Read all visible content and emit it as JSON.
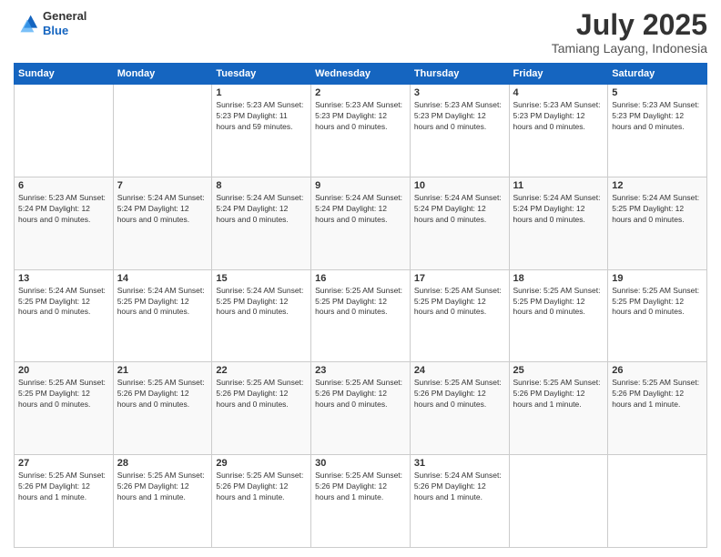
{
  "logo": {
    "line1": "General",
    "line2": "Blue"
  },
  "header": {
    "month": "July 2025",
    "location": "Tamiang Layang, Indonesia"
  },
  "weekdays": [
    "Sunday",
    "Monday",
    "Tuesday",
    "Wednesday",
    "Thursday",
    "Friday",
    "Saturday"
  ],
  "weeks": [
    [
      {
        "day": "",
        "info": ""
      },
      {
        "day": "",
        "info": ""
      },
      {
        "day": "1",
        "info": "Sunrise: 5:23 AM\nSunset: 5:23 PM\nDaylight: 11 hours\nand 59 minutes."
      },
      {
        "day": "2",
        "info": "Sunrise: 5:23 AM\nSunset: 5:23 PM\nDaylight: 12 hours\nand 0 minutes."
      },
      {
        "day": "3",
        "info": "Sunrise: 5:23 AM\nSunset: 5:23 PM\nDaylight: 12 hours\nand 0 minutes."
      },
      {
        "day": "4",
        "info": "Sunrise: 5:23 AM\nSunset: 5:23 PM\nDaylight: 12 hours\nand 0 minutes."
      },
      {
        "day": "5",
        "info": "Sunrise: 5:23 AM\nSunset: 5:23 PM\nDaylight: 12 hours\nand 0 minutes."
      }
    ],
    [
      {
        "day": "6",
        "info": "Sunrise: 5:23 AM\nSunset: 5:24 PM\nDaylight: 12 hours\nand 0 minutes."
      },
      {
        "day": "7",
        "info": "Sunrise: 5:24 AM\nSunset: 5:24 PM\nDaylight: 12 hours\nand 0 minutes."
      },
      {
        "day": "8",
        "info": "Sunrise: 5:24 AM\nSunset: 5:24 PM\nDaylight: 12 hours\nand 0 minutes."
      },
      {
        "day": "9",
        "info": "Sunrise: 5:24 AM\nSunset: 5:24 PM\nDaylight: 12 hours\nand 0 minutes."
      },
      {
        "day": "10",
        "info": "Sunrise: 5:24 AM\nSunset: 5:24 PM\nDaylight: 12 hours\nand 0 minutes."
      },
      {
        "day": "11",
        "info": "Sunrise: 5:24 AM\nSunset: 5:24 PM\nDaylight: 12 hours\nand 0 minutes."
      },
      {
        "day": "12",
        "info": "Sunrise: 5:24 AM\nSunset: 5:25 PM\nDaylight: 12 hours\nand 0 minutes."
      }
    ],
    [
      {
        "day": "13",
        "info": "Sunrise: 5:24 AM\nSunset: 5:25 PM\nDaylight: 12 hours\nand 0 minutes."
      },
      {
        "day": "14",
        "info": "Sunrise: 5:24 AM\nSunset: 5:25 PM\nDaylight: 12 hours\nand 0 minutes."
      },
      {
        "day": "15",
        "info": "Sunrise: 5:24 AM\nSunset: 5:25 PM\nDaylight: 12 hours\nand 0 minutes."
      },
      {
        "day": "16",
        "info": "Sunrise: 5:25 AM\nSunset: 5:25 PM\nDaylight: 12 hours\nand 0 minutes."
      },
      {
        "day": "17",
        "info": "Sunrise: 5:25 AM\nSunset: 5:25 PM\nDaylight: 12 hours\nand 0 minutes."
      },
      {
        "day": "18",
        "info": "Sunrise: 5:25 AM\nSunset: 5:25 PM\nDaylight: 12 hours\nand 0 minutes."
      },
      {
        "day": "19",
        "info": "Sunrise: 5:25 AM\nSunset: 5:25 PM\nDaylight: 12 hours\nand 0 minutes."
      }
    ],
    [
      {
        "day": "20",
        "info": "Sunrise: 5:25 AM\nSunset: 5:25 PM\nDaylight: 12 hours\nand 0 minutes."
      },
      {
        "day": "21",
        "info": "Sunrise: 5:25 AM\nSunset: 5:26 PM\nDaylight: 12 hours\nand 0 minutes."
      },
      {
        "day": "22",
        "info": "Sunrise: 5:25 AM\nSunset: 5:26 PM\nDaylight: 12 hours\nand 0 minutes."
      },
      {
        "day": "23",
        "info": "Sunrise: 5:25 AM\nSunset: 5:26 PM\nDaylight: 12 hours\nand 0 minutes."
      },
      {
        "day": "24",
        "info": "Sunrise: 5:25 AM\nSunset: 5:26 PM\nDaylight: 12 hours\nand 0 minutes."
      },
      {
        "day": "25",
        "info": "Sunrise: 5:25 AM\nSunset: 5:26 PM\nDaylight: 12 hours\nand 1 minute."
      },
      {
        "day": "26",
        "info": "Sunrise: 5:25 AM\nSunset: 5:26 PM\nDaylight: 12 hours\nand 1 minute."
      }
    ],
    [
      {
        "day": "27",
        "info": "Sunrise: 5:25 AM\nSunset: 5:26 PM\nDaylight: 12 hours\nand 1 minute."
      },
      {
        "day": "28",
        "info": "Sunrise: 5:25 AM\nSunset: 5:26 PM\nDaylight: 12 hours\nand 1 minute."
      },
      {
        "day": "29",
        "info": "Sunrise: 5:25 AM\nSunset: 5:26 PM\nDaylight: 12 hours\nand 1 minute."
      },
      {
        "day": "30",
        "info": "Sunrise: 5:25 AM\nSunset: 5:26 PM\nDaylight: 12 hours\nand 1 minute."
      },
      {
        "day": "31",
        "info": "Sunrise: 5:24 AM\nSunset: 5:26 PM\nDaylight: 12 hours\nand 1 minute."
      },
      {
        "day": "",
        "info": ""
      },
      {
        "day": "",
        "info": ""
      }
    ]
  ]
}
